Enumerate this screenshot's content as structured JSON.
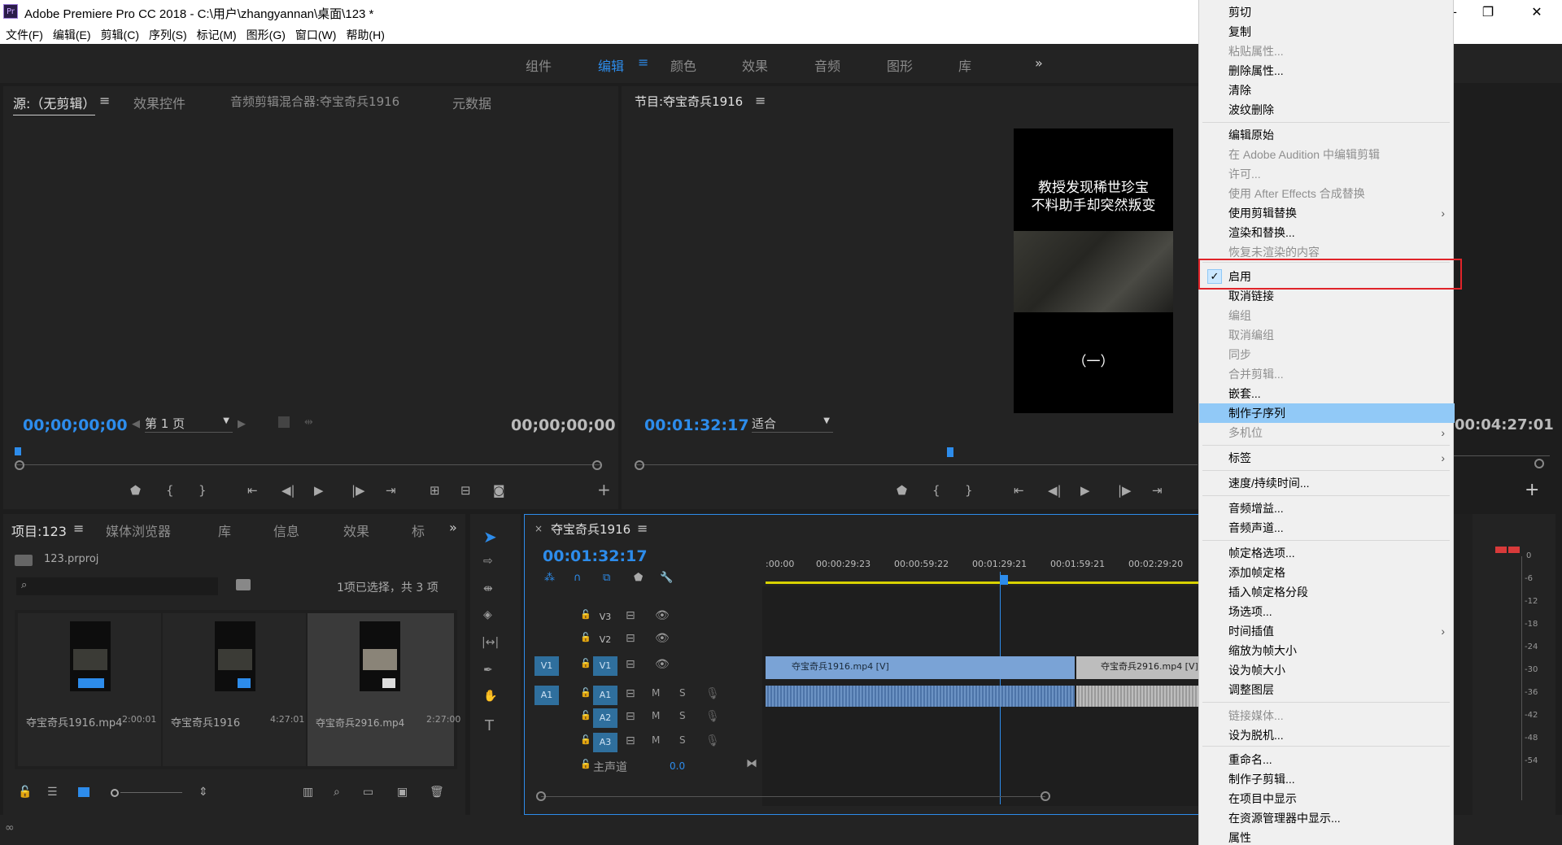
{
  "app": {
    "title": "Adobe Premiere Pro CC 2018 - C:\\用户\\zhangyannan\\桌面\\123 *",
    "logo": "Pr"
  },
  "window_buttons": {
    "minimize": "—",
    "maximize": "❐",
    "close": "✕"
  },
  "menubar": [
    "文件(F)",
    "编辑(E)",
    "剪辑(C)",
    "序列(S)",
    "标记(M)",
    "图形(G)",
    "窗口(W)",
    "帮助(H)"
  ],
  "workspaces": {
    "items": [
      "组件",
      "编辑",
      "颜色",
      "效果",
      "音频",
      "图形",
      "库"
    ],
    "active": "编辑",
    "overflow": "»"
  },
  "source_panel": {
    "tabs": [
      "源:（无剪辑）",
      "效果控件",
      "音频剪辑混合器:夺宝奇兵1916",
      "元数据"
    ],
    "timecode_left": "00;00;00;00",
    "timecode_right": "00;00;00;00",
    "page_select": "第 1 页"
  },
  "program_panel": {
    "title": "节目:夺宝奇兵1916",
    "timecode": "00:01:32:17",
    "fit": "适合",
    "timecode_right": "00:04:27:01",
    "video_title_line1": "教授发现稀世珍宝",
    "video_title_line2": "不料助手却突然叛变",
    "video_subtitle": "（一）"
  },
  "project_panel": {
    "tabs": [
      "项目:123",
      "媒体浏览器",
      "库",
      "信息",
      "效果",
      "标"
    ],
    "file": "123.prproj",
    "selection": "1项已选择，共 3 项",
    "items": [
      {
        "name": "夺宝奇兵1916.mp4",
        "duration": "2:00:01"
      },
      {
        "name": "夺宝奇兵1916",
        "duration": "4:27:01"
      },
      {
        "name": "夺宝奇兵2916.mp4",
        "duration": "2:27:00"
      }
    ]
  },
  "timeline": {
    "title": "夺宝奇兵1916",
    "timecode": "00:01:32:17",
    "ruler": [
      ":00:00",
      "00:00:29:23",
      "00:00:59:22",
      "00:01:29:21",
      "00:01:59:21",
      "00:02:29:20"
    ],
    "tracks_video": [
      "V3",
      "V2",
      "V1"
    ],
    "tracks_audio": [
      "A1",
      "A2",
      "A3"
    ],
    "master": "主声道",
    "master_val": "0.0",
    "clip1": "夺宝奇兵1916.mp4 [V]",
    "clip2": "夺宝奇兵2916.mp4 [V]",
    "src_v": "V1",
    "src_a": "A1",
    "m": "M",
    "s": "S"
  },
  "vu_scale": [
    "0",
    "-6",
    "-12",
    "-18",
    "-24",
    "-30",
    "-36",
    "-42",
    "-48",
    "-54"
  ],
  "context_menu": {
    "items": [
      {
        "label": "剪切",
        "state": "enabled"
      },
      {
        "label": "复制",
        "state": "enabled"
      },
      {
        "label": "粘贴属性...",
        "state": "disabled"
      },
      {
        "label": "删除属性...",
        "state": "enabled"
      },
      {
        "label": "清除",
        "state": "enabled"
      },
      {
        "label": "波纹删除",
        "state": "enabled"
      },
      {
        "label": "编辑原始",
        "state": "enabled"
      },
      {
        "label": "在 Adobe Audition 中编辑剪辑",
        "state": "disabled"
      },
      {
        "label": "许可...",
        "state": "disabled"
      },
      {
        "label": "使用 After Effects 合成替换",
        "state": "disabled"
      },
      {
        "label": "使用剪辑替换",
        "state": "enabled",
        "submenu": "›"
      },
      {
        "label": "渲染和替换...",
        "state": "enabled"
      },
      {
        "label": "恢复未渲染的内容",
        "state": "disabled"
      },
      {
        "label": "启用",
        "state": "checked"
      },
      {
        "label": "取消链接",
        "state": "enabled"
      },
      {
        "label": "编组",
        "state": "disabled"
      },
      {
        "label": "取消编组",
        "state": "disabled"
      },
      {
        "label": "同步",
        "state": "disabled"
      },
      {
        "label": "合并剪辑...",
        "state": "disabled"
      },
      {
        "label": "嵌套...",
        "state": "enabled"
      },
      {
        "label": "制作子序列",
        "state": "highlighted"
      },
      {
        "label": "多机位",
        "state": "disabled",
        "submenu": "›"
      },
      {
        "label": "标签",
        "state": "enabled",
        "submenu": "›"
      },
      {
        "label": "速度/持续时间...",
        "state": "enabled"
      },
      {
        "label": "音频增益...",
        "state": "enabled"
      },
      {
        "label": "音频声道...",
        "state": "enabled"
      },
      {
        "label": "帧定格选项...",
        "state": "enabled"
      },
      {
        "label": "添加帧定格",
        "state": "enabled"
      },
      {
        "label": "插入帧定格分段",
        "state": "enabled"
      },
      {
        "label": "场选项...",
        "state": "enabled"
      },
      {
        "label": "时间插值",
        "state": "enabled",
        "submenu": "›"
      },
      {
        "label": "缩放为帧大小",
        "state": "enabled"
      },
      {
        "label": "设为帧大小",
        "state": "enabled"
      },
      {
        "label": "调整图层",
        "state": "enabled"
      },
      {
        "label": "链接媒体...",
        "state": "disabled"
      },
      {
        "label": "设为脱机...",
        "state": "enabled"
      },
      {
        "label": "重命名...",
        "state": "enabled"
      },
      {
        "label": "制作子剪辑...",
        "state": "enabled"
      },
      {
        "label": "在项目中显示",
        "state": "enabled"
      },
      {
        "label": "在资源管理器中显示...",
        "state": "enabled"
      },
      {
        "label": "属性",
        "state": "enabled"
      }
    ]
  },
  "colors": {
    "accent": "#2d8ceb",
    "highlight_box": "#e0242a",
    "menu_highlight": "#91c9f7",
    "clip_blue": "#7aa3d6"
  }
}
